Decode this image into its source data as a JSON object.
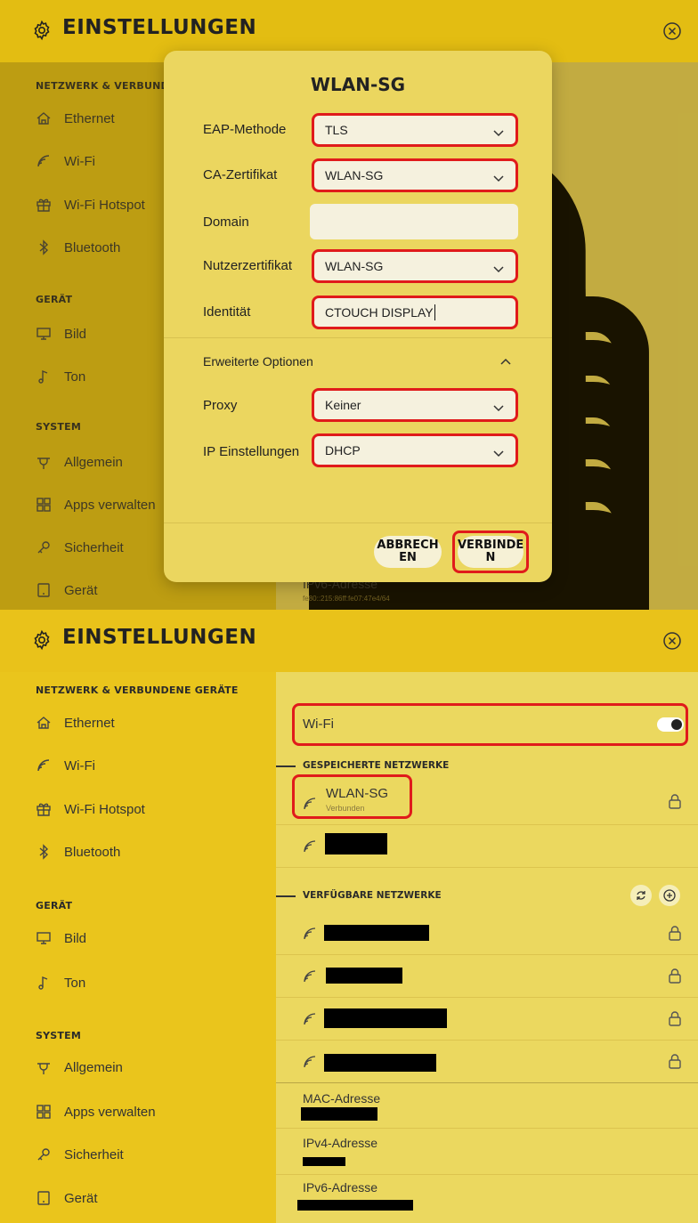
{
  "top": {
    "app_title": "EINSTELLUNGEN",
    "sidebar": {
      "section_network": "NETZWERK & VERBUNDEN",
      "section_device": "GERÄT",
      "section_system": "SYSTEM",
      "items": [
        "Ethernet",
        "Wi-Fi",
        "Wi-Fi Hotspot",
        "Bluetooth",
        "Bild",
        "Ton",
        "Allgemein",
        "Apps verwalten",
        "Sicherheit",
        "Gerät"
      ]
    },
    "ipv6": {
      "label": "IPv6-Adresse",
      "value": "fe80::215:86ff:fe07:47e4/64"
    },
    "dialog": {
      "title": "WLAN-SG",
      "eap_label": "EAP-Methode",
      "eap_value": "TLS",
      "ca_label": "CA-Zertifikat",
      "ca_value": "WLAN-SG",
      "domain_label": "Domain",
      "domain_value": "",
      "user_cert_label": "Nutzerzertifikat",
      "user_cert_value": "WLAN-SG",
      "identity_label": "Identität",
      "identity_value": "CTOUCH DISPLAY",
      "advanced_label": "Erweiterte Optionen",
      "proxy_label": "Proxy",
      "proxy_value": "Keiner",
      "ip_label": "IP Einstellungen",
      "ip_value": "DHCP",
      "cancel_label": "ABBRECH EN",
      "connect_label": "VERBINDE N"
    }
  },
  "bottom": {
    "app_title": "EINSTELLUNGEN",
    "sidebar": {
      "section_network": "NETZWERK & VERBUNDENE GERÄTE",
      "section_device": "GERÄT",
      "section_system": "SYSTEM",
      "items": [
        "Ethernet",
        "Wi-Fi",
        "Wi-Fi Hotspot",
        "Bluetooth",
        "Bild",
        "Ton",
        "Allgemein",
        "Apps verwalten",
        "Sicherheit",
        "Gerät"
      ]
    },
    "wifi_label": "Wi-Fi",
    "wifi_on": true,
    "saved_heading": "GESPEICHERTE NETZWERKE",
    "saved_network": {
      "name": "WLAN-SG",
      "status": "Verbunden"
    },
    "available_heading": "VERFÜGBARE NETZWERKE",
    "mac_label": "MAC-Adresse",
    "ipv4_label": "IPv4-Adresse",
    "ipv6_label": "IPv6-Adresse"
  },
  "colors": {
    "accent": "#e4bf1a",
    "highlight": "#e01b1b",
    "panel": "#ead35a"
  }
}
